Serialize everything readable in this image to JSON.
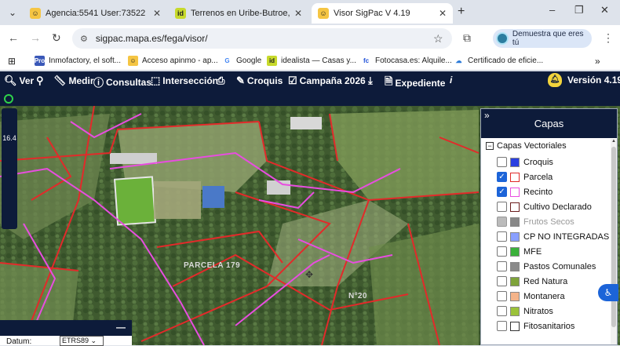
{
  "browser": {
    "tabs": [
      {
        "title": "Agencia:5541 User:73522",
        "favicon": "amber-person-icon",
        "active": false
      },
      {
        "title": "Terrenos en Uribe-Butroe, Vizca",
        "favicon": "idealista-icon",
        "active": false
      },
      {
        "title": "Visor SigPac V 4.19",
        "favicon": "amber-person-icon",
        "active": true
      }
    ],
    "close_symbol": "✕",
    "new_tab_symbol": "+",
    "window_controls": {
      "minimize": "–",
      "restore": "❐",
      "close": "✕"
    },
    "address": "sigpac.mapa.es/fega/visor/",
    "profile_chip": "Demuestra que eres tú",
    "bookmarks": [
      {
        "label": "Inmofactory, el soft...",
        "icon": "Pro",
        "color": "#3a58b8"
      },
      {
        "label": "Acceso apinmo - ap...",
        "icon": "person",
        "color": "#c79a2b"
      },
      {
        "label": "Google",
        "icon": "G",
        "color": "#ffffff"
      },
      {
        "label": "idealista — Casas y...",
        "icon": "id",
        "color": "#c7d92b"
      },
      {
        "label": "Fotocasa.es: Alquile...",
        "icon": "fc",
        "color": "#ffffff"
      },
      {
        "label": "Certificado de eficie...",
        "icon": "cloud",
        "color": "#ffffff"
      }
    ],
    "bookmarks_more": "»"
  },
  "toolbar": {
    "ver": "Ver",
    "medir": "Medir",
    "consultas": "Consultas",
    "interseccion": "Intersección",
    "croquis": "Croquis",
    "campana": "Campaña 2026",
    "expediente": "Expediente",
    "info": "i",
    "version": "Versión 4.19"
  },
  "map": {
    "zoom_level": "16.4",
    "labels": {
      "parcela": "PARCELA 179",
      "n": "Nº20"
    }
  },
  "datum": {
    "label": "Datum:",
    "value": "ETRS89",
    "minimize": "—"
  },
  "layers": {
    "title": "Capas",
    "collapse_symbol": "»",
    "group": "Capas Vectoriales",
    "items": [
      {
        "label": "Croquis",
        "checked": false,
        "color": "#2a3fe0",
        "disabled": false
      },
      {
        "label": "Parcela",
        "checked": true,
        "color": "#e02a2a",
        "disabled": false
      },
      {
        "label": "Recinto",
        "checked": true,
        "color": "#e84de0",
        "disabled": false
      },
      {
        "label": "Cultivo Declarado",
        "checked": false,
        "color": "#6b1d1d",
        "disabled": false
      },
      {
        "label": "Frutos Secos",
        "checked": false,
        "color": "#888888",
        "disabled": true
      },
      {
        "label": "CP NO INTEGRADAS",
        "checked": false,
        "color": "#8aa0ff",
        "disabled": false
      },
      {
        "label": "MFE",
        "checked": false,
        "color": "#3bb13b",
        "disabled": false
      },
      {
        "label": "Pastos Comunales",
        "checked": false,
        "color": "#8a8a8a",
        "disabled": false
      },
      {
        "label": "Red Natura",
        "checked": false,
        "color": "#7ea33a",
        "disabled": false
      },
      {
        "label": "Montanera",
        "checked": false,
        "color": "#f4b48a",
        "disabled": false
      },
      {
        "label": "Nitratos",
        "checked": false,
        "color": "#9bc23a",
        "disabled": false
      },
      {
        "label": "Fitosanitarios",
        "checked": false,
        "color": "#333333",
        "disabled": false
      }
    ]
  }
}
